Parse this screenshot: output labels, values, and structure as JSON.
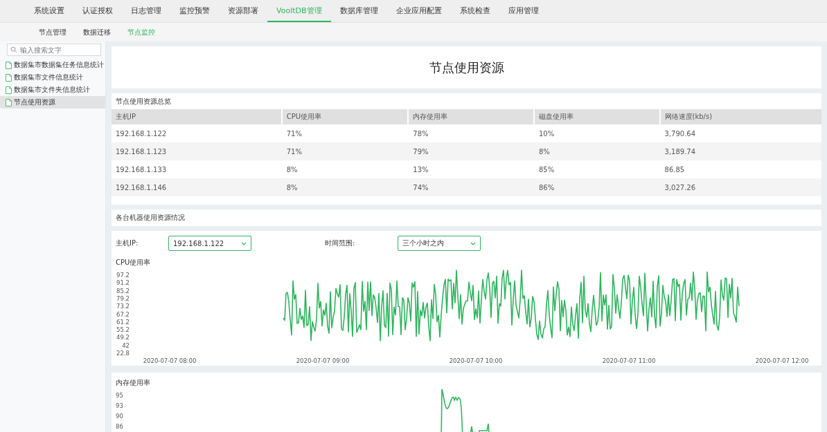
{
  "top_nav": [
    {
      "label": "系统设置",
      "selected": false
    },
    {
      "label": "认证授权",
      "selected": false
    },
    {
      "label": "日志管理",
      "selected": false
    },
    {
      "label": "监控预警",
      "selected": false
    },
    {
      "label": "资源部署",
      "selected": false
    },
    {
      "label": "VooltDB管理",
      "selected": true
    },
    {
      "label": "数据库管理",
      "selected": false
    },
    {
      "label": "企业应用配置",
      "selected": false
    },
    {
      "label": "系统检查",
      "selected": false
    },
    {
      "label": "应用管理",
      "selected": false
    }
  ],
  "sub_nav": [
    {
      "label": "节点管理",
      "selected": false
    },
    {
      "label": "数据迁移",
      "selected": false
    },
    {
      "label": "节点监控",
      "selected": true
    }
  ],
  "sidebar": {
    "search": {
      "placeholder": "输入搜索文字"
    },
    "items": [
      {
        "label": "数据集市数据集任务信息统计",
        "selected": false
      },
      {
        "label": "数据集市文件信息统计",
        "selected": false
      },
      {
        "label": "数据集市文件夹信息统计",
        "selected": false
      },
      {
        "label": "节点使用资源",
        "selected": true
      }
    ]
  },
  "page_title": "节点使用资源",
  "overview": {
    "title": "节点使用资源总览",
    "columns": [
      "主机IP",
      "CPU使用率",
      "内存使用率",
      "磁盘使用率",
      "网络速度(kb/s)"
    ],
    "rows": [
      [
        "192.168.1.122",
        "71%",
        "78%",
        "10%",
        "3,790.64"
      ],
      [
        "192.168.1.123",
        "71%",
        "79%",
        "8%",
        "3,189.74"
      ],
      [
        "192.168.1.133",
        "8%",
        "13%",
        "85%",
        "86.85"
      ],
      [
        "192.168.1.146",
        "8%",
        "74%",
        "86%",
        "3,027.26"
      ]
    ]
  },
  "machines": {
    "title": "各台机器使用资源情况",
    "host_ip": {
      "label": "主机IP:",
      "value": "192.168.1.122"
    },
    "time_range": {
      "label": "时间范围:",
      "value": "三个小时之内"
    },
    "charts": [
      {
        "kind": "cpu",
        "title": "CPU使用率",
        "yticks": [
          "97.2",
          "91.2",
          "85.2",
          "79.2",
          "73.2",
          "67.2",
          "61.2",
          "55.2",
          "49.2",
          "42",
          "22.8"
        ],
        "xticks": [
          "2020-07-07 08:00",
          "2020-07-07 09:00",
          "2020-07-07 10:00",
          "2020-07-07 11:00",
          "2020-07-07 12:00"
        ]
      },
      {
        "kind": "memory",
        "title": "内存使用率",
        "yticks": [
          "95",
          "93",
          "90",
          "86"
        ]
      }
    ]
  }
}
